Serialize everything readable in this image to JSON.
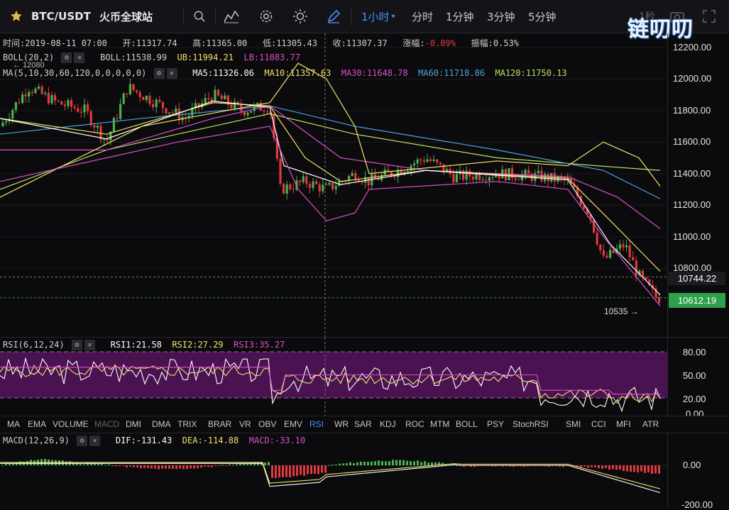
{
  "header": {
    "symbol": "BTC/USDT",
    "exchange": "火币全球站",
    "intervals": [
      "1小时",
      "分时",
      "1分钟",
      "3分钟",
      "5分钟"
    ],
    "active_interval": "1小时",
    "right_partial": "1秒"
  },
  "watermark": "链叨叨",
  "info": {
    "time_label": "时间:",
    "time": "2019-08-11 07:00",
    "open_label": "开:",
    "open": "11317.74",
    "high_label": "高:",
    "high": "11365.00",
    "low_label": "低:",
    "low": "11305.43",
    "close_label": "收:",
    "close": "11307.37",
    "change_label": "涨幅:",
    "change": "-0.09%",
    "amp_label": "振幅:",
    "amp": "0.53%"
  },
  "boll": {
    "name": "BOLL(20,2)",
    "boll_label": "BOLL:11538.99",
    "ub_label": "UB:11994.21",
    "lb_label": "LB:11083.77"
  },
  "ma": {
    "name": "MA(5,10,30,60,120,0,0,0,0,0)",
    "ma5": "MA5:11326.06",
    "ma10": "MA10:11357.63",
    "ma30": "MA30:11648.78",
    "ma60": "MA60:11718.86",
    "ma120": "MA120:11750.13"
  },
  "price_axis": [
    "12200.00",
    "12000.00",
    "11800.00",
    "11600.00",
    "11400.00",
    "11200.00",
    "11000.00",
    "10800.00"
  ],
  "price_tags": {
    "crosshair": "10744.22",
    "last": "10612.19",
    "low_marker": "10535 →",
    "high_marker": "← 12080"
  },
  "rsi": {
    "name": "RSI(6,12,24)",
    "rsi1": "RSI1:21.58",
    "rsi2": "RSI2:27.29",
    "rsi3": "RSI3:35.27",
    "axis": [
      "80.00",
      "50.00",
      "20.00",
      "0.00"
    ]
  },
  "indicator_tabs": [
    "MA",
    "EMA",
    "VOLUME",
    "MACD",
    "DMI",
    "DMA",
    "TRIX",
    "BRAR",
    "VR",
    "OBV",
    "EMV",
    "RSI",
    "WR",
    "SAR",
    "KDJ",
    "ROC",
    "MTM",
    "BOLL",
    "PSY",
    "StochRSI",
    "SMI",
    "CCI",
    "MFI",
    "ATR"
  ],
  "active_tab": "RSI",
  "macd": {
    "name": "MACD(12,26,9)",
    "dif": "DIF:-131.43",
    "dea": "DEA:-114.88",
    "macd": "MACD:-33.10",
    "axis": [
      "0.00",
      "-200.00"
    ]
  },
  "colors": {
    "up": "#4caf50",
    "down": "#e0393e",
    "ma5": "#ffffff",
    "ma10": "#f2e16b",
    "ma30": "#d650c8",
    "ma60": "#4aa3df",
    "ma120": "#b9e06a",
    "accent": "#4b8cf5"
  },
  "icons": [
    "star-icon",
    "search-icon",
    "indicator-icon",
    "gear-icon",
    "theme-icon",
    "draw-icon",
    "chevron-down-icon",
    "camera-icon",
    "fullscreen-icon"
  ]
}
